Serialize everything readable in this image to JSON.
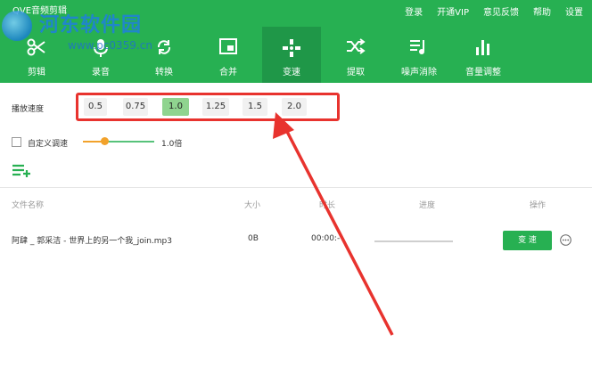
{
  "app": {
    "title": "QVE音频剪辑",
    "title_icon": "music-note-icon"
  },
  "watermark": {
    "text": "河东软件园",
    "url": "www.pc0359.cn"
  },
  "top_menu": [
    "登录",
    "开通VIP",
    "意见反馈",
    "帮助",
    "设置"
  ],
  "tools": [
    {
      "label": "剪辑",
      "icon": "scissors-icon"
    },
    {
      "label": "录音",
      "icon": "microphone-icon"
    },
    {
      "label": "转换",
      "icon": "convert-icon"
    },
    {
      "label": "合并",
      "icon": "merge-icon"
    },
    {
      "label": "变速",
      "icon": "gamepad-icon",
      "active": true
    },
    {
      "label": "提取",
      "icon": "shuffle-icon"
    },
    {
      "label": "噪声消除",
      "icon": "noise-icon"
    },
    {
      "label": "音量调整",
      "icon": "volume-bars-icon"
    }
  ],
  "speed": {
    "label": "播放速度",
    "options": [
      "0.5",
      "0.75",
      "1.0",
      "1.25",
      "1.5",
      "2.0"
    ],
    "selected": "1.0"
  },
  "custom_speed": {
    "label": "自定义调速",
    "checked": false,
    "value": "1.0倍",
    "slider_fraction": 0.3
  },
  "table": {
    "headers": {
      "name": "文件名称",
      "size": "大小",
      "duration": "时长",
      "progress": "进度",
      "action": "操作"
    },
    "rows": [
      {
        "name": "阿肆 _ 郭采洁 - 世界上的另一个我_join.mp3",
        "size": "0B",
        "duration": "00:00:-",
        "action": "变 速"
      }
    ]
  },
  "colors": {
    "brand": "#27b052",
    "brand_active": "#1f9748",
    "highlight": "#e8332e",
    "selected_speed": "#8fd48f",
    "slider": "#f2a22b"
  }
}
